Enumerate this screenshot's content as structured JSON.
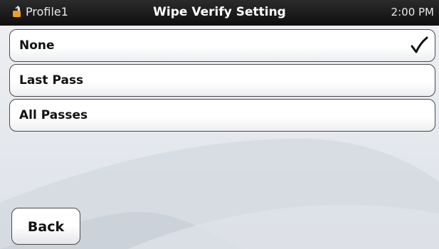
{
  "status_bar": {
    "profile": "Profile1",
    "title": "Wipe Verify Setting",
    "time": "2:00 PM",
    "lock_icon": "unlocked-padlock-icon"
  },
  "options": [
    {
      "label": "None",
      "selected": true
    },
    {
      "label": "Last Pass",
      "selected": false
    },
    {
      "label": "All Passes",
      "selected": false
    }
  ],
  "selected_indicator_icon": "checkmark-icon",
  "back_button": {
    "label": "Back"
  },
  "colors": {
    "status_bar": "#1a1a1a",
    "lock_icon": "#f0a020",
    "background": "#e6e9ee",
    "button_border": "#4a4a4a"
  }
}
